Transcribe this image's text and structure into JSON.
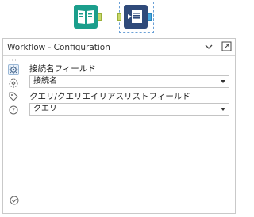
{
  "workflow": {
    "tools": [
      {
        "icon": "input-book-icon",
        "color": "#1b9e8c"
      },
      {
        "icon": "output-table-icon",
        "color": "#2f4a7a"
      }
    ]
  },
  "config": {
    "title": "Workflow - Configuration",
    "fields": [
      {
        "label": "接続名フィールド",
        "value": "接続名"
      },
      {
        "label": "クエリ/クエリエイリアスリストフィールド",
        "value": "クエリ"
      }
    ]
  },
  "side_icons": [
    "settings-icon",
    "annotation-icon",
    "tag-icon",
    "help-icon"
  ],
  "colors": {
    "accent": "#1b9e8c",
    "output_tool": "#2f4a7a",
    "anchor": "#c8d86b",
    "anchor_out": "#47a9e0"
  }
}
